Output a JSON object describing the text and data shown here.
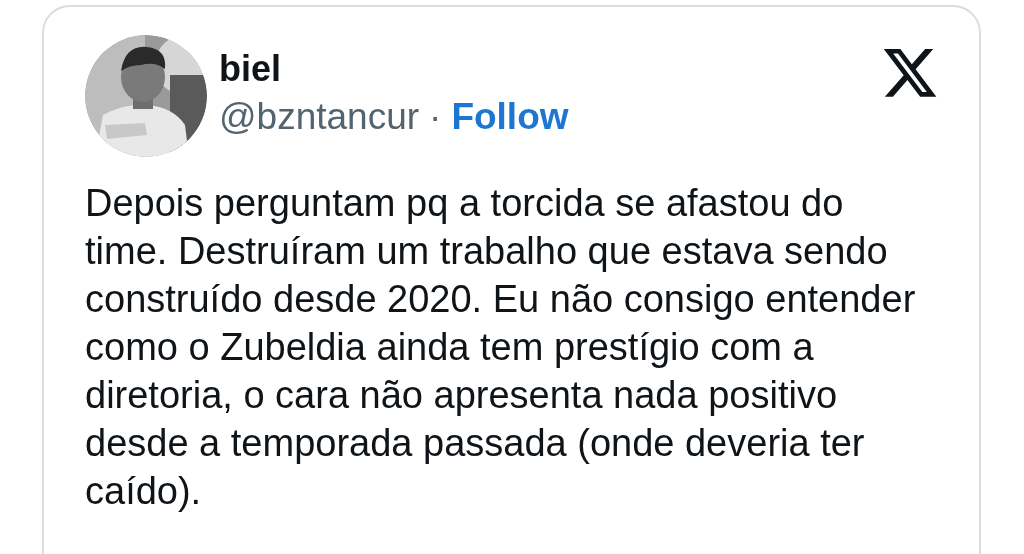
{
  "author": {
    "name": "biel",
    "handle": "@bzntancur",
    "separator": "·",
    "follow": "Follow"
  },
  "text": "Depois perguntam pq a torcida se afastou do time. Destruíram um trabalho que estava sendo construído desde 2020. Eu não consigo entender como o Zubeldia ainda tem prestígio com a diretoria, o cara não apresenta nada positivo desde a temporada passada (onde deveria ter caído)."
}
